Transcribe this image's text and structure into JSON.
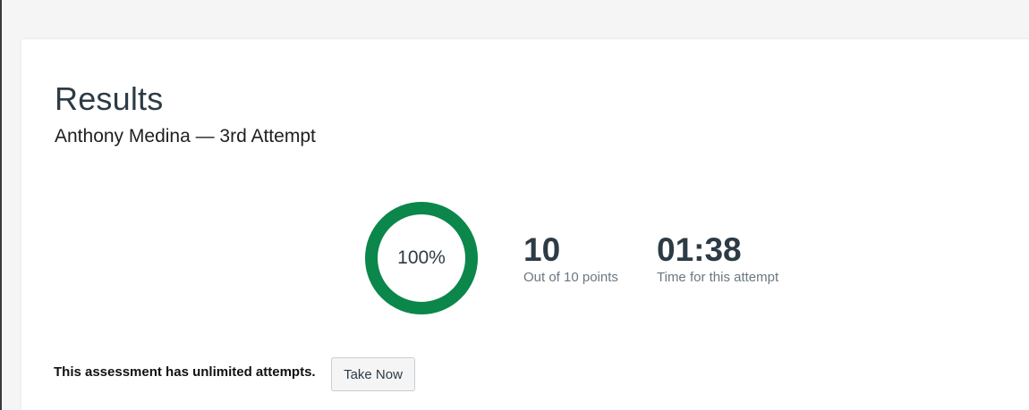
{
  "results": {
    "title": "Results",
    "subtitle": "Anthony Medina — 3rd Attempt"
  },
  "score": {
    "percent_label": "100%",
    "percent_value": 100,
    "ring_color": "#0b874b"
  },
  "stats": {
    "points_value": "10",
    "points_label": "Out of 10 points",
    "time_value": "01:38",
    "time_label": "Time for this attempt"
  },
  "footer": {
    "attempts_text": "This assessment has unlimited attempts.",
    "take_now_label": "Take Now"
  }
}
